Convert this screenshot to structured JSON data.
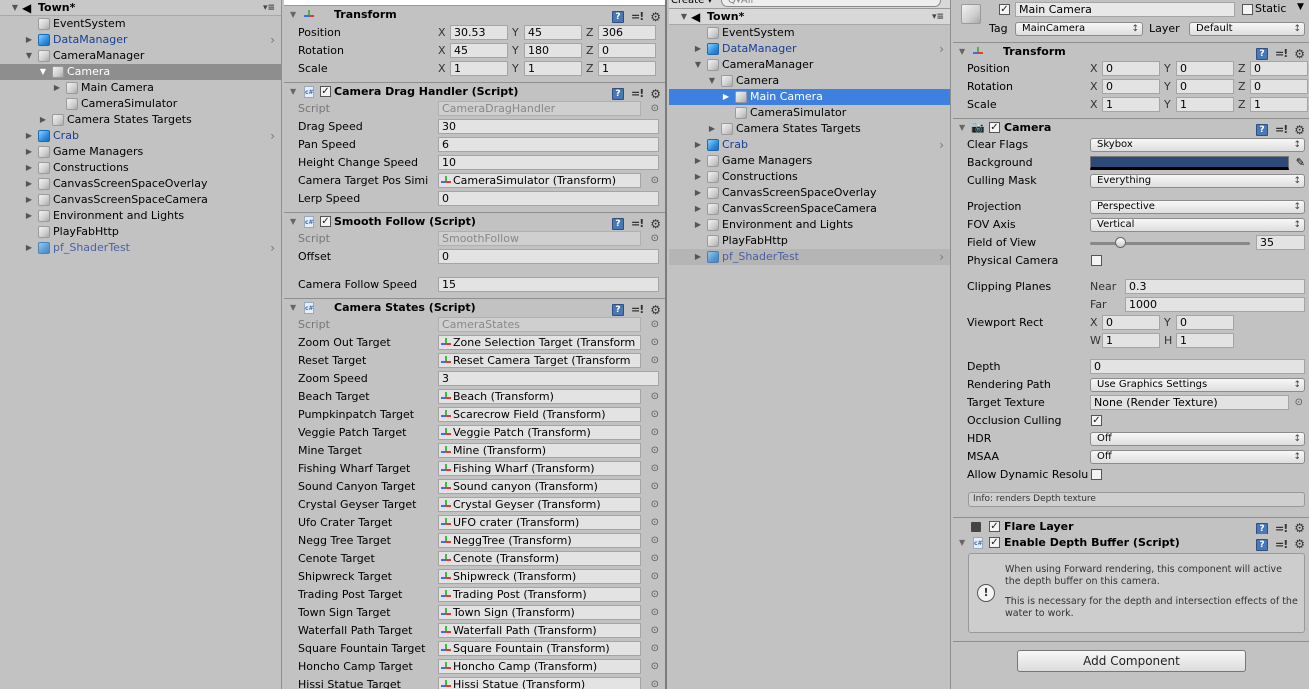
{
  "left_hierarchy": {
    "scene": "Town*",
    "items": [
      {
        "name": "EventSystem",
        "depth": 1,
        "arrow": "",
        "type": "plain"
      },
      {
        "name": "DataManager",
        "depth": 1,
        "arrow": "collapsed",
        "type": "prefab",
        "chevron": true
      },
      {
        "name": "CameraManager",
        "depth": 1,
        "arrow": "expanded",
        "type": "plain"
      },
      {
        "name": "Camera",
        "depth": 2,
        "arrow": "expanded",
        "type": "plain",
        "selected": "gray"
      },
      {
        "name": "Main Camera",
        "depth": 3,
        "arrow": "collapsed",
        "type": "plain"
      },
      {
        "name": "CameraSimulator",
        "depth": 3,
        "arrow": "",
        "type": "plain"
      },
      {
        "name": "Camera States Targets",
        "depth": 2,
        "arrow": "collapsed",
        "type": "plain"
      },
      {
        "name": "Crab",
        "depth": 1,
        "arrow": "collapsed",
        "type": "prefab",
        "chevron": true
      },
      {
        "name": "Game Managers",
        "depth": 1,
        "arrow": "collapsed",
        "type": "plain"
      },
      {
        "name": "Constructions",
        "depth": 1,
        "arrow": "collapsed",
        "type": "plain"
      },
      {
        "name": "CanvasScreenSpaceOverlay",
        "depth": 1,
        "arrow": "collapsed",
        "type": "plain"
      },
      {
        "name": "CanvasScreenSpaceCamera",
        "depth": 1,
        "arrow": "collapsed",
        "type": "plain"
      },
      {
        "name": "Environment and Lights",
        "depth": 1,
        "arrow": "collapsed",
        "type": "plain"
      },
      {
        "name": "PlayFabHttp",
        "depth": 1,
        "arrow": "",
        "type": "plain"
      },
      {
        "name": "pf_ShaderTest",
        "depth": 1,
        "arrow": "collapsed",
        "type": "prefab-faded",
        "chevron": true
      }
    ]
  },
  "left_inspector": {
    "transform": {
      "title": "Transform",
      "rows": [
        {
          "label": "Position",
          "x": "30.53",
          "y": "45",
          "z": "306"
        },
        {
          "label": "Rotation",
          "x": "45",
          "y": "180",
          "z": "0"
        },
        {
          "label": "Scale",
          "x": "1",
          "y": "1",
          "z": "1"
        }
      ]
    },
    "drag_handler": {
      "title": "Camera Drag Handler (Script)",
      "script_label": "Script",
      "script_value": "CameraDragHandler",
      "fields": [
        {
          "label": "Drag Speed",
          "value": "30"
        },
        {
          "label": "Pan Speed",
          "value": "6"
        },
        {
          "label": "Height Change Speed",
          "value": "10"
        }
      ],
      "sim_label": "Camera Target Pos Simi",
      "sim_value": "CameraSimulator (Transform)",
      "lerp_label": "Lerp Speed",
      "lerp_value": "0"
    },
    "smooth_follow": {
      "title": "Smooth Follow (Script)",
      "script_label": "Script",
      "script_value": "SmoothFollow",
      "offset_label": "Offset",
      "offset_value": "0",
      "speed_label": "Camera Follow Speed",
      "speed_value": "15"
    },
    "camera_states": {
      "title": "Camera States (Script)",
      "script_label": "Script",
      "script_value": "CameraStates",
      "targets_top": [
        {
          "label": "Zoom Out Target",
          "value": "Zone Selection Target (Transform"
        },
        {
          "label": "Reset Target",
          "value": "Reset Camera Target (Transform"
        }
      ],
      "zoom_label": "Zoom Speed",
      "zoom_value": "3",
      "targets": [
        {
          "label": "Beach Target",
          "value": "Beach (Transform)"
        },
        {
          "label": "Pumpkinpatch Target",
          "value": "Scarecrow Field (Transform)"
        },
        {
          "label": "Veggie Patch Target",
          "value": "Veggie Patch (Transform)"
        },
        {
          "label": "Mine Target",
          "value": "Mine (Transform)"
        },
        {
          "label": "Fishing Wharf Target",
          "value": "Fishing Wharf (Transform)"
        },
        {
          "label": "Sound Canyon Target",
          "value": "Sound canyon (Transform)"
        },
        {
          "label": "Crystal Geyser Target",
          "value": "Crystal Geyser (Transform)"
        },
        {
          "label": "Ufo Crater Target",
          "value": "UFO crater (Transform)"
        },
        {
          "label": "Negg Tree Target",
          "value": "NeggTree (Transform)"
        },
        {
          "label": "Cenote Target",
          "value": "Cenote (Transform)"
        },
        {
          "label": "Shipwreck Target",
          "value": "Shipwreck (Transform)"
        },
        {
          "label": "Trading Post Target",
          "value": "Trading Post (Transform)"
        },
        {
          "label": "Town Sign Target",
          "value": "Town Sign (Transform)"
        },
        {
          "label": "Waterfall Path Target",
          "value": "Waterfall Path (Transform)"
        },
        {
          "label": "Square Fountain Target",
          "value": "Square Fountain (Transform)"
        },
        {
          "label": "Honcho Camp Target",
          "value": "Honcho Camp (Transform)"
        },
        {
          "label": "Hissi Statue Target",
          "value": "Hissi Statue (Transform)"
        }
      ]
    }
  },
  "right_hierarchy": {
    "create_label": "Create",
    "search_placeholder": "All",
    "scene": "Town*",
    "items": [
      {
        "name": "EventSystem",
        "depth": 1,
        "arrow": "",
        "type": "plain"
      },
      {
        "name": "DataManager",
        "depth": 1,
        "arrow": "collapsed",
        "type": "prefab",
        "chevron": true
      },
      {
        "name": "CameraManager",
        "depth": 1,
        "arrow": "expanded",
        "type": "plain"
      },
      {
        "name": "Camera",
        "depth": 2,
        "arrow": "expanded",
        "type": "plain"
      },
      {
        "name": "Main Camera",
        "depth": 3,
        "arrow": "collapsed",
        "type": "plain",
        "selected": "blue"
      },
      {
        "name": "CameraSimulator",
        "depth": 3,
        "arrow": "",
        "type": "plain"
      },
      {
        "name": "Camera States Targets",
        "depth": 2,
        "arrow": "collapsed",
        "type": "plain"
      },
      {
        "name": "Crab",
        "depth": 1,
        "arrow": "collapsed",
        "type": "prefab",
        "chevron": true
      },
      {
        "name": "Game Managers",
        "depth": 1,
        "arrow": "collapsed",
        "type": "plain"
      },
      {
        "name": "Constructions",
        "depth": 1,
        "arrow": "collapsed",
        "type": "plain"
      },
      {
        "name": "CanvasScreenSpaceOverlay",
        "depth": 1,
        "arrow": "collapsed",
        "type": "plain"
      },
      {
        "name": "CanvasScreenSpaceCamera",
        "depth": 1,
        "arrow": "collapsed",
        "type": "plain"
      },
      {
        "name": "Environment and Lights",
        "depth": 1,
        "arrow": "collapsed",
        "type": "plain"
      },
      {
        "name": "PlayFabHttp",
        "depth": 1,
        "arrow": "",
        "type": "plain"
      },
      {
        "name": "pf_ShaderTest",
        "depth": 1,
        "arrow": "collapsed",
        "type": "prefab-faded",
        "chevron": true,
        "hover": true
      }
    ]
  },
  "right_inspector": {
    "object_name": "Main Camera",
    "static_label": "Static",
    "tag_label": "Tag",
    "tag_value": "MainCamera",
    "layer_label": "Layer",
    "layer_value": "Default",
    "transform": {
      "title": "Transform",
      "rows": [
        {
          "label": "Position",
          "x": "0",
          "y": "0",
          "z": "0"
        },
        {
          "label": "Rotation",
          "x": "0",
          "y": "0",
          "z": "0"
        },
        {
          "label": "Scale",
          "x": "1",
          "y": "1",
          "z": "1"
        }
      ]
    },
    "camera": {
      "title": "Camera",
      "clear_flags_label": "Clear Flags",
      "clear_flags": "Skybox",
      "background_label": "Background",
      "background_color": "#2c4a78",
      "culling_label": "Culling Mask",
      "culling": "Everything",
      "projection_label": "Projection",
      "projection": "Perspective",
      "fov_axis_label": "FOV Axis",
      "fov_axis": "Vertical",
      "fov_label": "Field of View",
      "fov": "35",
      "fov_slider_fraction": 0.19,
      "physical_label": "Physical Camera",
      "clipping_label": "Clipping Planes",
      "near_label": "Near",
      "near": "0.3",
      "far_label": "Far",
      "far": "1000",
      "viewport_label": "Viewport Rect",
      "vx": "0",
      "vy": "0",
      "vw": "1",
      "vh": "1",
      "depth_label": "Depth",
      "depth": "0",
      "rendering_path_label": "Rendering Path",
      "rendering_path": "Use Graphics Settings",
      "target_texture_label": "Target Texture",
      "target_texture": "None (Render Texture)",
      "occlusion_label": "Occlusion Culling",
      "hdr_label": "HDR",
      "hdr": "Off",
      "msaa_label": "MSAA",
      "msaa": "Off",
      "dynres_label": "Allow Dynamic Resolu",
      "info": "Info: renders Depth texture"
    },
    "flare_layer": {
      "title": "Flare Layer"
    },
    "depth_buffer": {
      "title": "Enable Depth Buffer (Script)",
      "msg1": "When using Forward rendering, this component will active the depth buffer on this camera.",
      "msg2": "This is necessary for the depth and intersection effects of the water to work."
    },
    "add_component": "Add Component"
  }
}
